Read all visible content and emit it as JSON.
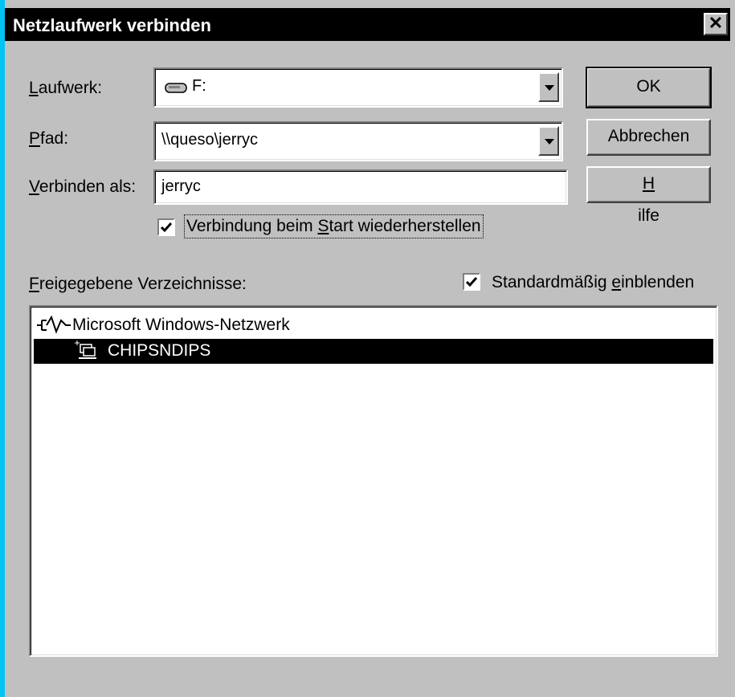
{
  "window": {
    "title": "Netzlaufwerk verbinden",
    "close_glyph": "✕"
  },
  "drive": {
    "label_prefix": "L",
    "label_rest": "aufwerk:",
    "value": "F:"
  },
  "path": {
    "label_prefix": "P",
    "label_rest": "fad:",
    "value": "\\\\queso\\jerryc"
  },
  "connect_as": {
    "label_prefix": "V",
    "label_rest": "erbinden als:",
    "value": "jerryc"
  },
  "reconnect": {
    "label_before": "Verbindung beim ",
    "label_accel": "S",
    "label_after": "tart wiederherstellen",
    "checked": true
  },
  "shared_folders": {
    "label_prefix": "F",
    "label_rest": "reigegebene Verzeichnisse:"
  },
  "expand_default": {
    "label_before": "Standardmäßig ",
    "label_accel": "e",
    "label_after": "inblenden",
    "checked": true
  },
  "buttons": {
    "ok": "OK",
    "cancel": "Abbrechen",
    "help_accel": "H",
    "help_rest": "ilfe"
  },
  "tree": [
    {
      "label": "Microsoft Windows-Netzwerk",
      "icon": "network-icon",
      "selected": false
    },
    {
      "label": "CHIPSNDIPS",
      "icon": "workgroup-icon",
      "selected": true
    }
  ],
  "colors": {
    "desktop": "#00c4f4",
    "face": "#c0c0c0",
    "titlebar": "#000000",
    "selection": "#000000"
  }
}
